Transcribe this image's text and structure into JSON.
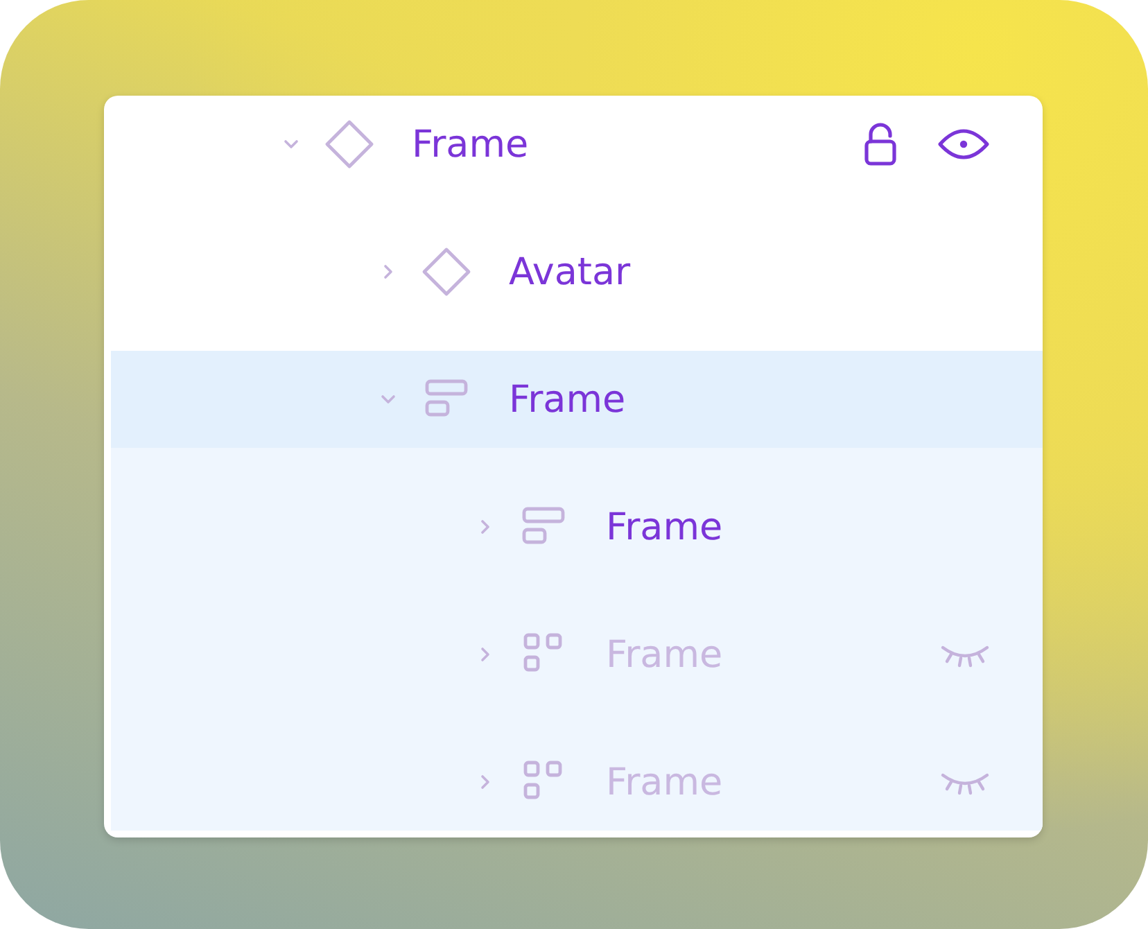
{
  "layers": [
    {
      "name": "Frame",
      "kind": "component",
      "expanded": true,
      "selected": false,
      "hovered": true,
      "locked": false,
      "hidden": false,
      "children": [
        {
          "name": "Avatar",
          "kind": "component",
          "expanded": false,
          "selected": false,
          "hovered": false,
          "locked": false,
          "hidden": false
        },
        {
          "name": "Frame",
          "kind": "stack",
          "expanded": true,
          "selected": true,
          "hovered": false,
          "locked": false,
          "hidden": false,
          "children": [
            {
              "name": "Frame",
              "kind": "stack",
              "expanded": false,
              "selected": false,
              "hovered": false,
              "locked": false,
              "hidden": false
            },
            {
              "name": "Frame",
              "kind": "grid",
              "expanded": false,
              "selected": false,
              "hovered": false,
              "locked": false,
              "hidden": true
            },
            {
              "name": "Frame",
              "kind": "grid",
              "expanded": false,
              "selected": false,
              "hovered": false,
              "locked": false,
              "hidden": true
            }
          ]
        }
      ]
    }
  ]
}
